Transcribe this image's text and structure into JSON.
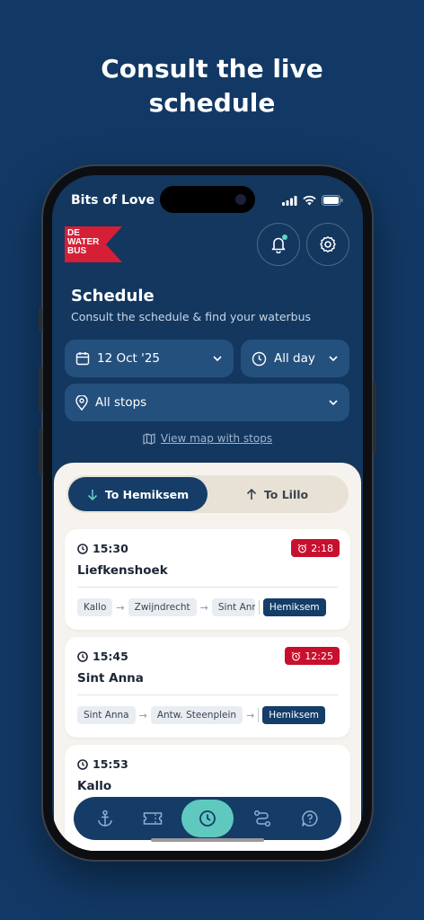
{
  "promo": {
    "line1": "Consult the live",
    "line2": "schedule"
  },
  "status_bar": {
    "carrier": "Bits of Love"
  },
  "logo": {
    "line1": "DE",
    "line2": "WATER",
    "line3": "BUS"
  },
  "header": {
    "title": "Schedule",
    "subtitle": "Consult the schedule & find your waterbus"
  },
  "filters": {
    "date": "12 Oct '25",
    "time": "All day",
    "stops": "All stops"
  },
  "map_link": "View map with stops",
  "direction_toggle": {
    "option1": "To Hemiksem",
    "option2": "To Lillo",
    "active": "To Hemiksem"
  },
  "departures": [
    {
      "time": "15:30",
      "countdown": "2:18",
      "stop": "Liefkenshoek",
      "route": [
        "Kallo",
        "Zwijndrecht",
        "Sint Anna"
      ],
      "destination": "Hemiksem"
    },
    {
      "time": "15:45",
      "countdown": "12:25",
      "stop": "Sint Anna",
      "route": [
        "Sint Anna",
        "Antw. Steenplein"
      ],
      "destination": "Hemiksem"
    },
    {
      "time": "15:53",
      "stop": "Kallo"
    }
  ],
  "colors": {
    "brand_navy": "#153d68",
    "accent_teal": "#5fc9c0",
    "alert_red": "#c8102e",
    "logo_red": "#d51f36"
  },
  "nav": {
    "items": [
      "anchor-icon",
      "ticket-icon",
      "clock-icon",
      "route-icon",
      "help-icon"
    ],
    "active": "clock-icon"
  }
}
